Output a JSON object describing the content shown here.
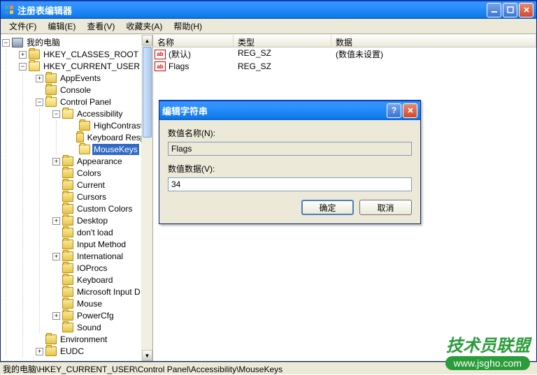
{
  "window": {
    "title": "注册表编辑器"
  },
  "menu": {
    "file": "文件(F)",
    "edit": "编辑(E)",
    "view": "查看(V)",
    "favorites": "收藏夹(A)",
    "help": "帮助(H)"
  },
  "tree": {
    "root": "我的电脑",
    "hkcr": "HKEY_CLASSES_ROOT",
    "hkcu": "HKEY_CURRENT_USER",
    "appevents": "AppEvents",
    "console": "Console",
    "controlpanel": "Control Panel",
    "accessibility": "Accessibility",
    "highcontrast": "HighContrast",
    "keyboardresp": "Keyboard Respo",
    "mousekeys": "MouseKeys",
    "appearance": "Appearance",
    "colors": "Colors",
    "current": "Current",
    "cursors": "Cursors",
    "customcolors": "Custom Colors",
    "desktop": "Desktop",
    "dontload": "don't load",
    "inputmethod": "Input Method",
    "international": "International",
    "ioprocs": "IOProcs",
    "keyboard": "Keyboard",
    "msinput": "Microsoft Input D",
    "mouse": "Mouse",
    "powercfg": "PowerCfg",
    "sound": "Sound",
    "environment": "Environment",
    "eudc": "EUDC"
  },
  "list": {
    "col_name": "名称",
    "col_type": "类型",
    "col_data": "数据",
    "rows": [
      {
        "name": "(默认)",
        "type": "REG_SZ",
        "data": "(数值未设置)"
      },
      {
        "name": "Flags",
        "type": "REG_SZ",
        "data": ""
      }
    ]
  },
  "dialog": {
    "title": "编辑字符串",
    "name_label": "数值名称(N):",
    "name_value": "Flags",
    "data_label": "数值数据(V):",
    "data_value": "34",
    "ok": "确定",
    "cancel": "取消"
  },
  "statusbar": "我的电脑\\HKEY_CURRENT_USER\\Control Panel\\Accessibility\\MouseKeys",
  "watermark": {
    "top": "技术员联盟",
    "bottom": "www.jsgho.com"
  }
}
